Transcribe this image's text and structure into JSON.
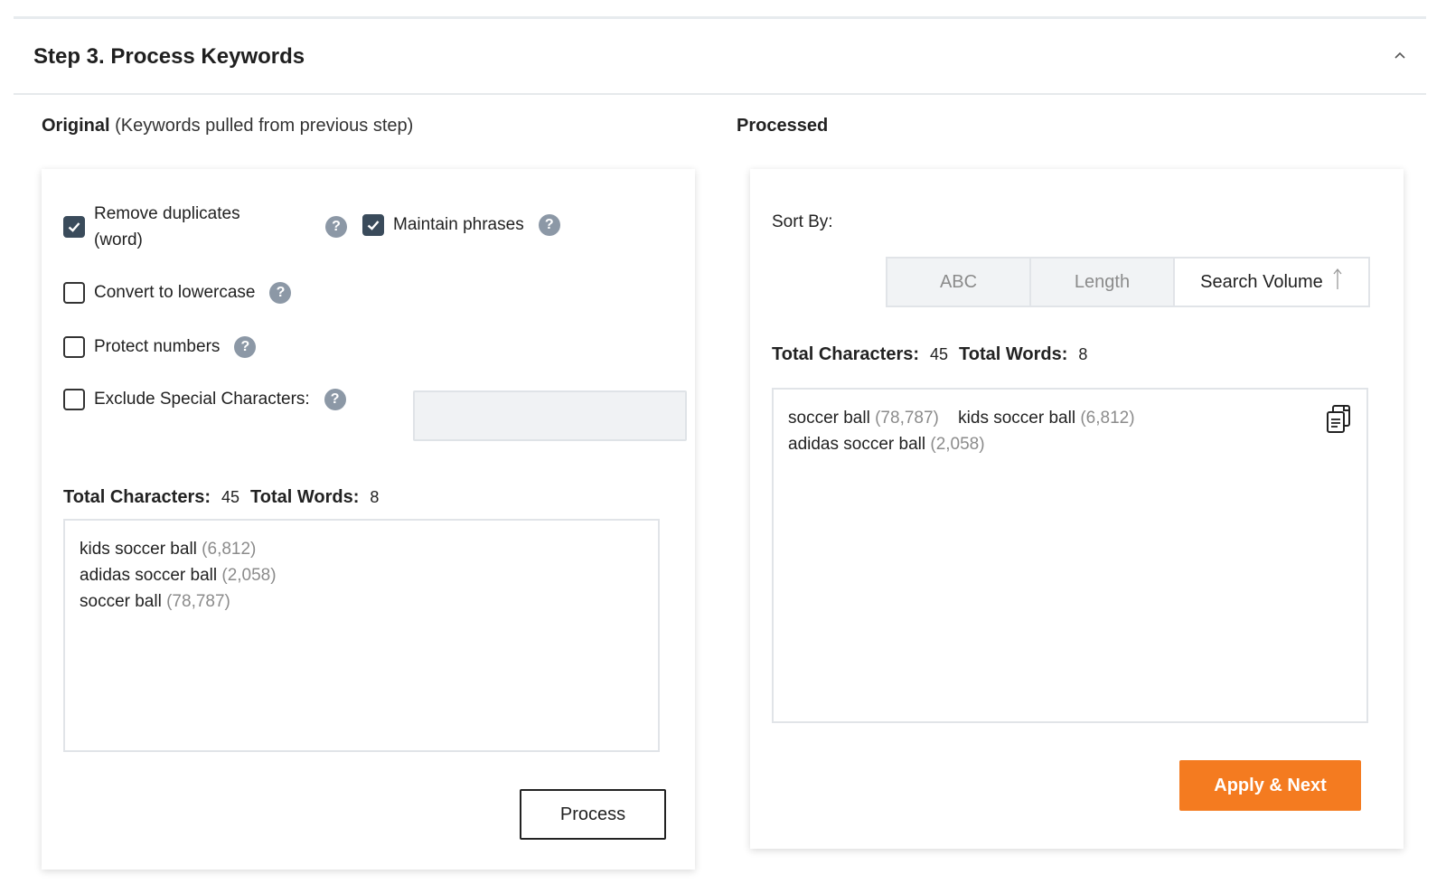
{
  "header": {
    "title": "Step 3. Process Keywords"
  },
  "original": {
    "label": "Original",
    "note": "(Keywords pulled from previous step)",
    "options": {
      "remove_duplicates": {
        "label_line1": "Remove duplicates",
        "label_line2": "(word)",
        "checked": true
      },
      "maintain_phrases": {
        "label": "Maintain phrases",
        "checked": true
      },
      "convert_lowercase": {
        "label": "Convert to lowercase",
        "checked": false
      },
      "protect_numbers": {
        "label": "Protect numbers",
        "checked": false
      },
      "exclude_special": {
        "label": "Exclude Special Characters:",
        "checked": false,
        "value": ""
      }
    },
    "totals": {
      "chars_label": "Total Characters:",
      "chars": "45",
      "words_label": "Total Words:",
      "words": "8"
    },
    "keywords": [
      {
        "text": "kids soccer ball",
        "volume": "(6,812)"
      },
      {
        "text": "adidas soccer ball",
        "volume": "(2,058)"
      },
      {
        "text": "soccer ball",
        "volume": "(78,787)"
      }
    ],
    "process_label": "Process"
  },
  "processed": {
    "label": "Processed",
    "sort_by_label": "Sort By:",
    "sort_options": [
      "ABC",
      "Length",
      "Search Volume"
    ],
    "active_sort": "Search Volume",
    "totals": {
      "chars_label": "Total Characters:",
      "chars": "45",
      "words_label": "Total Words:",
      "words": "8"
    },
    "keywords": [
      {
        "text": "soccer ball",
        "volume": "(78,787)"
      },
      {
        "text": "kids soccer ball",
        "volume": "(6,812)"
      },
      {
        "text": "adidas soccer ball",
        "volume": "(2,058)"
      }
    ],
    "apply_label": "Apply & Next"
  },
  "icons": {
    "collapse": "chevron-up-icon",
    "help": "question-circle-icon",
    "copy": "copy-clipboard-icon",
    "sort_direction": "arrow-up-icon"
  },
  "colors": {
    "accent_orange": "#f47b20",
    "checkbox_checked": "#3a4b5b",
    "help_icon": "#8c98a6",
    "muted_text": "#8b8b8b"
  }
}
